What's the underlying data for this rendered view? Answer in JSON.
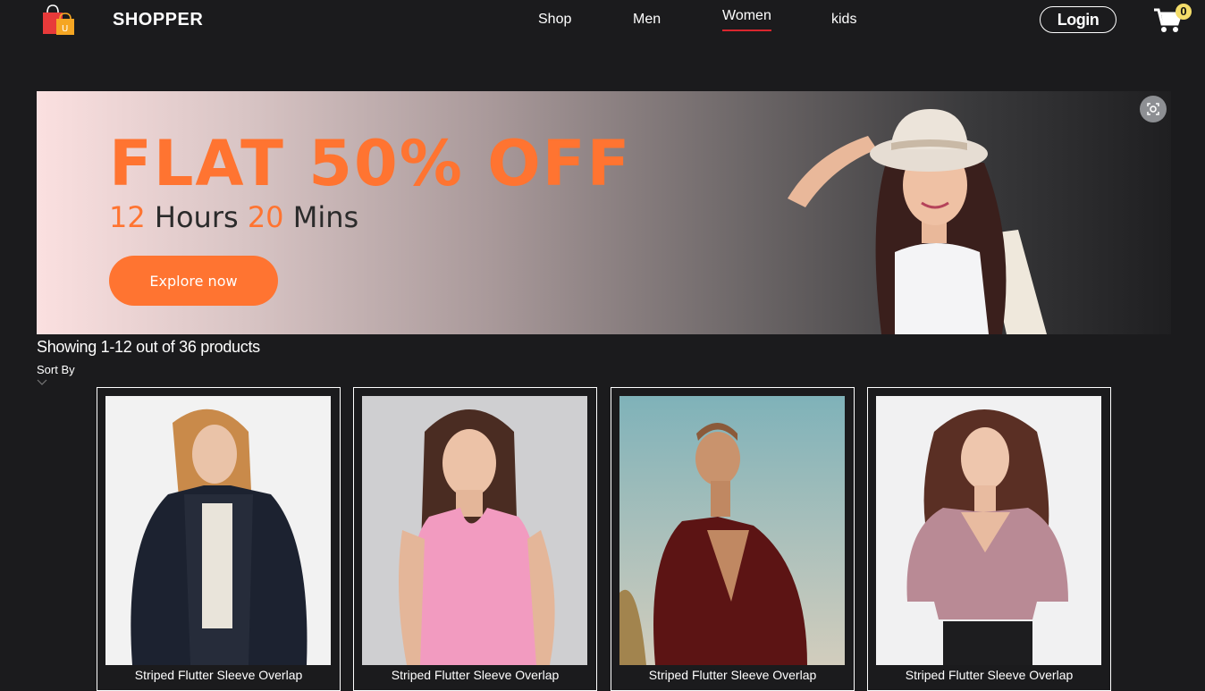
{
  "nav": {
    "brand": "SHOPPER",
    "items": [
      {
        "label": "Shop",
        "active": false
      },
      {
        "label": "Men",
        "active": false
      },
      {
        "label": "Women",
        "active": true
      },
      {
        "label": "kids",
        "active": false
      }
    ],
    "login_label": "Login",
    "cart_count": "0",
    "accent": "#d9262e"
  },
  "banner": {
    "title": "FLAT 50% OFF",
    "hours_num": "12",
    "hours_label": "Hours",
    "mins_num": "20",
    "mins_label": "Mins",
    "cta": "Explore now",
    "accent": "#ff7431"
  },
  "listing": {
    "showing": "Showing 1-12 out of 36 products",
    "sort_label": "Sort By"
  },
  "products": [
    {
      "name": "Striped Flutter Sleeve Overlap"
    },
    {
      "name": "Striped Flutter Sleeve Overlap"
    },
    {
      "name": "Striped Flutter Sleeve Overlap"
    },
    {
      "name": "Striped Flutter Sleeve Overlap"
    }
  ]
}
